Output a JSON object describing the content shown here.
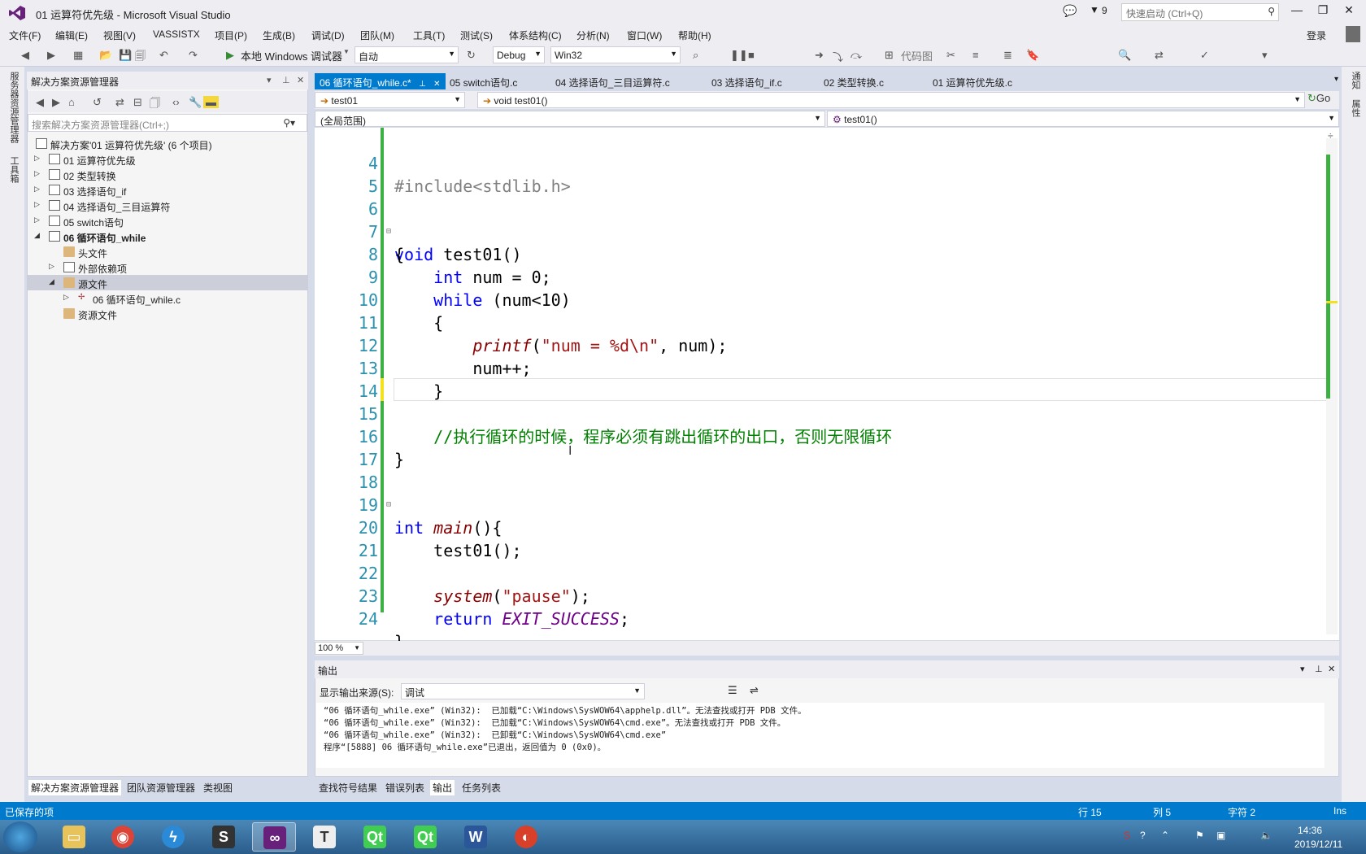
{
  "window": {
    "title": "01 运算符优先级 - Microsoft Visual Studio",
    "filter_count": "9",
    "quick_launch_placeholder": "快速启动 (Ctrl+Q)",
    "login": "登录"
  },
  "menu": [
    "文件(F)",
    "编辑(E)",
    "视图(V)",
    "VASSISTX",
    "项目(P)",
    "生成(B)",
    "调试(D)",
    "团队(M)",
    "工具(T)",
    "测试(S)",
    "体系结构(C)",
    "分析(N)",
    "窗口(W)",
    "帮助(H)"
  ],
  "toolbar": {
    "start_label": "本地 Windows 调试器",
    "config_auto": "自动",
    "config_debug": "Debug",
    "platform": "Win32",
    "code_map": "代码图"
  },
  "left_strip": {
    "server_explorer": "服务器资源管理器",
    "toolbox": "工具箱"
  },
  "right_strip": {
    "notifications": "通知",
    "properties": "属性"
  },
  "solution_explorer": {
    "title": "解决方案资源管理器",
    "search_placeholder": "搜索解决方案资源管理器(Ctrl+;)",
    "items": [
      {
        "label": "解决方案'01 运算符优先级' (6 个项目)"
      },
      {
        "label": "01 运算符优先级"
      },
      {
        "label": "02 类型转换"
      },
      {
        "label": "03 选择语句_if"
      },
      {
        "label": "04 选择语句_三目运算符"
      },
      {
        "label": "05 switch语句"
      },
      {
        "label": "06 循环语句_while"
      },
      {
        "label": "头文件"
      },
      {
        "label": "外部依赖项"
      },
      {
        "label": "源文件"
      },
      {
        "label": "06 循环语句_while.c"
      },
      {
        "label": "资源文件"
      }
    ],
    "bottom_tabs": [
      "解决方案资源管理器",
      "团队资源管理器",
      "类视图"
    ]
  },
  "editor": {
    "tabs": [
      "06 循环语句_while.c*",
      "05 switch语句.c",
      "04 选择语句_三目运算符.c",
      "03 选择语句_if.c",
      "02 类型转换.c",
      "01 运算符优先级.c"
    ],
    "nav_scope": "test01",
    "nav_member": "void test01()",
    "go": "Go",
    "nav_global": "(全局范围)",
    "nav_func": "test01()",
    "zoom": "100 %",
    "lines": [
      {
        "n": "4",
        "t": "#include<stdlib.h>"
      },
      {
        "n": "5",
        "t": ""
      },
      {
        "n": "6",
        "t": "void test01()"
      },
      {
        "n": "7",
        "t": "{"
      },
      {
        "n": "8",
        "t": "    int num = 0;"
      },
      {
        "n": "9",
        "t": "    while (num<10)"
      },
      {
        "n": "10",
        "t": "    {"
      },
      {
        "n": "11",
        "t": "        printf(\"num = %d\\n\", num);"
      },
      {
        "n": "12",
        "t": "        num++;"
      },
      {
        "n": "13",
        "t": "    }"
      },
      {
        "n": "14",
        "t": ""
      },
      {
        "n": "15",
        "t": "    //执行循环的时候，程序必须有跳出循环的出口，否则无限循环"
      },
      {
        "n": "16",
        "t": "}"
      },
      {
        "n": "17",
        "t": ""
      },
      {
        "n": "18",
        "t": "int main(){"
      },
      {
        "n": "19",
        "t": ""
      },
      {
        "n": "20",
        "t": "    test01();"
      },
      {
        "n": "21",
        "t": ""
      },
      {
        "n": "22",
        "t": "    system(\"pause\");"
      },
      {
        "n": "23",
        "t": "    return EXIT_SUCCESS;"
      },
      {
        "n": "24",
        "t": "}"
      }
    ]
  },
  "output": {
    "title": "输出",
    "source_label": "显示输出来源(S):",
    "source_value": "调试",
    "lines": [
      "“06 循环语句_while.exe” (Win32):  已加载“C:\\Windows\\SysWOW64\\apphelp.dll”。无法查找或打开 PDB 文件。",
      "“06 循环语句_while.exe” (Win32):  已加载“C:\\Windows\\SysWOW64\\cmd.exe”。无法查找或打开 PDB 文件。",
      "“06 循环语句_while.exe” (Win32):  已卸载“C:\\Windows\\SysWOW64\\cmd.exe”",
      "程序“[5888] 06 循环语句_while.exe”已退出，返回值为 0 (0x0)。"
    ],
    "bottom_tabs": [
      "查找符号结果",
      "错误列表",
      "输出",
      "任务列表"
    ]
  },
  "status": {
    "left": "已保存的项",
    "line": "行 15",
    "col": "列 5",
    "char": "字符 2",
    "mode": "Ins"
  },
  "taskbar": {
    "time": "14:36",
    "date": "2019/12/11"
  }
}
